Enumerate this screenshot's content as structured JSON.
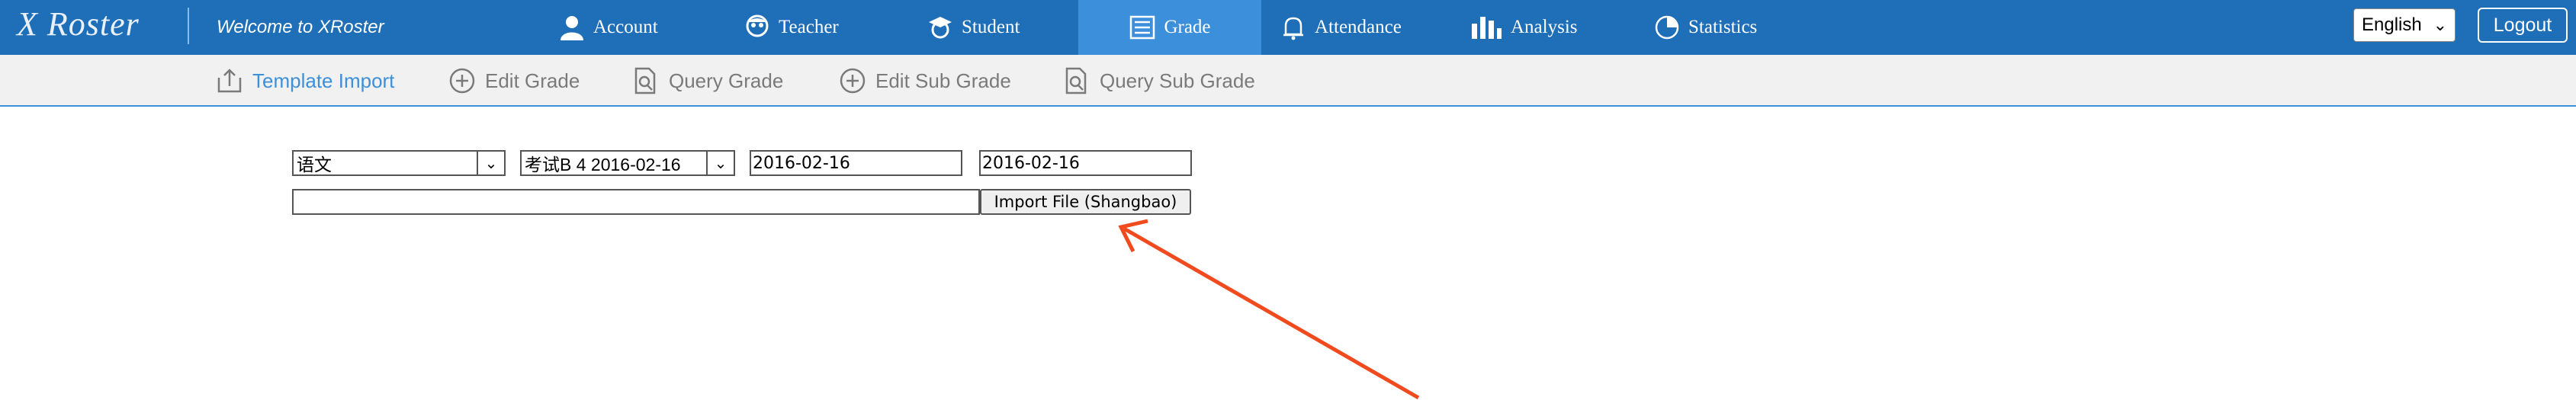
{
  "header": {
    "logo_text": "X Roster",
    "welcome": "Welcome to XRoster",
    "nav": [
      {
        "label": "Account",
        "icon": "user-icon"
      },
      {
        "label": "Teacher",
        "icon": "teacher-icon"
      },
      {
        "label": "Student",
        "icon": "student-icon"
      },
      {
        "label": "Grade",
        "icon": "list-icon",
        "active": true
      },
      {
        "label": "Attendance",
        "icon": "bell-icon"
      },
      {
        "label": "Analysis",
        "icon": "bar-chart-icon"
      },
      {
        "label": "Statistics",
        "icon": "pie-chart-icon"
      }
    ],
    "language": "English",
    "logout_label": "Logout"
  },
  "subnav": [
    {
      "label": "Template Import",
      "icon": "upload-icon",
      "active": true
    },
    {
      "label": "Edit Grade",
      "icon": "plus-circle-icon"
    },
    {
      "label": "Query Grade",
      "icon": "document-search-icon"
    },
    {
      "label": "Edit Sub Grade",
      "icon": "plus-circle-icon"
    },
    {
      "label": "Query Sub Grade",
      "icon": "document-search-icon"
    }
  ],
  "form": {
    "subject_selected": "语文",
    "exam_selected": "考试B 4 2016-02-16",
    "start_date": "2016-02-16",
    "end_date": "2016-02-16",
    "file_path": "",
    "import_button_label": "Import File (Shangbao)"
  },
  "colors": {
    "topbar": "#1e6eb8",
    "active_tab": "#3c8fdb",
    "subbar": "#f1f1f1",
    "annotation_arrow": "#f04a1e"
  }
}
